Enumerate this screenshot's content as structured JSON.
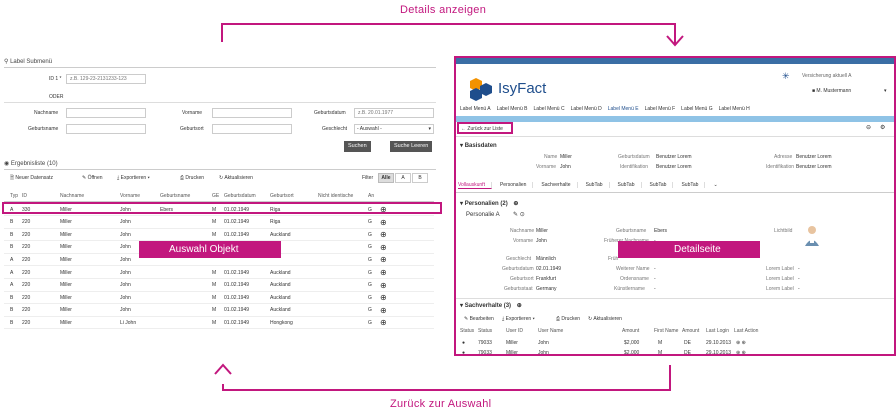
{
  "captions": {
    "top": "Details  anzeigen",
    "bottom": "Zurück zur  Auswahl",
    "auswahl_objekt": "Auswahl Objekt",
    "detailseite": "Detailseite"
  },
  "left": {
    "section_title": "Label Submenü",
    "id_label": "ID 1 *",
    "id_placeholder": "z.B. 129-23-2131233-123",
    "oder": "ODER",
    "nachname_label": "Nachname",
    "vorname_label": "Vorname",
    "geburtsdatum_label": "Geburtsdatum",
    "geburtsdatum_placeholder": "z.B. 20.01.1977",
    "geburtsname_label": "Geburtsname",
    "geburtsort_label": "Geburtsort",
    "geschlecht_label": "Geschlecht",
    "geschlecht_value": "- Auswahl -",
    "suchen": "Suchen",
    "suche_leeren": "Suche Leeren",
    "results_title": "Ergebnisliste (10)",
    "toolbar": {
      "neuer_datensatz": "Neuer Datensatz",
      "oeffnen": "Öffnen",
      "exportieren": "Exportieren",
      "drucken": "Drucken",
      "aktualisieren": "Aktualisieren",
      "filter": "Filter",
      "filter_alle": "Alle",
      "filter_a": "A",
      "filter_b": "B"
    },
    "columns": [
      "Typ",
      "ID",
      "Nachname",
      "Vorname",
      "Geburtsname",
      "GE",
      "Geburtsdatum",
      "Geburtsort",
      "Nicht identische",
      "An"
    ],
    "rows": [
      {
        "typ": "A",
        "id": "330",
        "nachname": "Miller",
        "vorname": "John",
        "geburtsname": "Ebers",
        "ge": "M",
        "datum": "01.02.1949",
        "ort": "Riga",
        "an": "G"
      },
      {
        "typ": "B",
        "id": "220",
        "nachname": "Miller",
        "vorname": "John",
        "geburtsname": "",
        "ge": "M",
        "datum": "01.02.1949",
        "ort": "Riga",
        "an": "G"
      },
      {
        "typ": "B",
        "id": "220",
        "nachname": "Miller",
        "vorname": "John",
        "geburtsname": "",
        "ge": "M",
        "datum": "01.02.1949",
        "ort": "Auckland",
        "an": "G"
      },
      {
        "typ": "B",
        "id": "220",
        "nachname": "Miller",
        "vorname": "John",
        "geburtsname": "",
        "ge": "",
        "datum": "",
        "ort": "",
        "an": "G"
      },
      {
        "typ": "A",
        "id": "220",
        "nachname": "Miller",
        "vorname": "John",
        "geburtsname": "",
        "ge": "",
        "datum": "",
        "ort": "",
        "an": "G"
      },
      {
        "typ": "A",
        "id": "220",
        "nachname": "Miller",
        "vorname": "John",
        "geburtsname": "",
        "ge": "M",
        "datum": "01.02.1949",
        "ort": "Auckland",
        "an": "G"
      },
      {
        "typ": "A",
        "id": "220",
        "nachname": "Miller",
        "vorname": "John",
        "geburtsname": "",
        "ge": "M",
        "datum": "01.02.1949",
        "ort": "Auckland",
        "an": "G"
      },
      {
        "typ": "B",
        "id": "220",
        "nachname": "Miller",
        "vorname": "John",
        "geburtsname": "",
        "ge": "M",
        "datum": "01.02.1949",
        "ort": "Auckland",
        "an": "G"
      },
      {
        "typ": "B",
        "id": "220",
        "nachname": "Miller",
        "vorname": "John",
        "geburtsname": "",
        "ge": "M",
        "datum": "01.02.1949",
        "ort": "Auckland",
        "an": "G"
      },
      {
        "typ": "B",
        "id": "220",
        "nachname": "Miller",
        "vorname": "Li John",
        "geburtsname": "",
        "ge": "M",
        "datum": "01.02.1949",
        "ort": "Hongkong",
        "an": "G"
      }
    ]
  },
  "right": {
    "logo_text": "IsyFact",
    "user_title": "Versicherung aktuell A",
    "user_name": "M. Mustermann",
    "menu": [
      "Label Menü A",
      "Label Menü B",
      "Label Menü C",
      "Label Menü D",
      "Label Menü E",
      "Label Menü F",
      "Label Menü G",
      "Label Menü H"
    ],
    "active_menu_index": 4,
    "zurueck": "Zurück zur Liste",
    "basisdaten_title": "Basisdaten",
    "basis": {
      "name_label": "Name",
      "name_value": "Miller",
      "vorname_label": "Vorname",
      "vorname_value": "John",
      "geburtsdatum_label": "Geburtsdatum",
      "geburtsdatum_value": "Benutzer Lorem",
      "identifikation_label": "Identifikation",
      "identifikation_value": "Benutzer Lorem",
      "adresse_label": "Adresse",
      "adresse_value": "Benutzer Lorem",
      "identifikation2_label": "Identifikation",
      "identifikation2_value": "Benutzer Lorem"
    },
    "tabs": [
      "Vollauskunft",
      "Personalien",
      "Sachverhalte",
      "SubTab",
      "SubTab",
      "SubTab",
      "SubTab"
    ],
    "personalien_title": "Personalien (2)",
    "personalie_a": "Personalie A",
    "pers": {
      "nachname_label": "Nachname",
      "nachname_value": "Miller",
      "vorname_label": "Vorname",
      "vorname_value": "John",
      "geburtsname_label": "Geburtsname",
      "geburtsname_value": "Ebers",
      "frueherer_label": "Früherer Nachname",
      "frueherer_value": "-",
      "lichtbild_label": "Lichtbild",
      "geschlecht_label": "Geschlecht",
      "geschlecht_value": "Männlich",
      "frueh_label": "Früh",
      "geburtsdatum_label": "Geburtsdatum",
      "geburtsdatum_value": "02.01.1949",
      "weiterer_label": "Weiterer Name",
      "weiterer_value": "-",
      "geburtsort_label": "Geburtsort",
      "geburtsort_value": "Frankfurt",
      "ordensname_label": "Ordensname",
      "ordensname_value": "-",
      "geburtsstaat_label": "Geburtsstaat",
      "geburtsstaat_value": "Germany",
      "kuenstlername_label": "Künstlername",
      "kuenstlername_value": "-",
      "lorem1_label": "Lorem Label",
      "lorem1_value": "-",
      "lorem2_label": "Lorem Label",
      "lorem2_value": "-",
      "lorem3_label": "Lorem Label",
      "lorem3_value": "-"
    },
    "sachverhalte_title": "Sachverhalte (3)",
    "sv_toolbar": {
      "bearbeiten": "Bearbeiten",
      "exportieren": "Exportieren",
      "drucken": "Drucken",
      "aktualisieren": "Aktualisieren"
    },
    "sv_columns": [
      "Status",
      "Status",
      "User ID",
      "User Name",
      "Amount",
      "First Name",
      "Amount",
      "Last Login",
      "Last Action"
    ],
    "sv_rows": [
      {
        "status": "79033",
        "userid": "Miller",
        "username": "John",
        "amount": "$2,000",
        "first": "M",
        "amount2": "DE",
        "login": "29.10.2013"
      },
      {
        "status": "79033",
        "userid": "Miller",
        "username": "John",
        "amount": "$2,000",
        "first": "M",
        "amount2": "DE",
        "login": "29.10.2013"
      }
    ]
  },
  "colors": {
    "accent": "#c2177e",
    "brand_blue": "#1f4e8c",
    "brand_orange": "#f39200",
    "top_bar": "#3a6ea5"
  }
}
